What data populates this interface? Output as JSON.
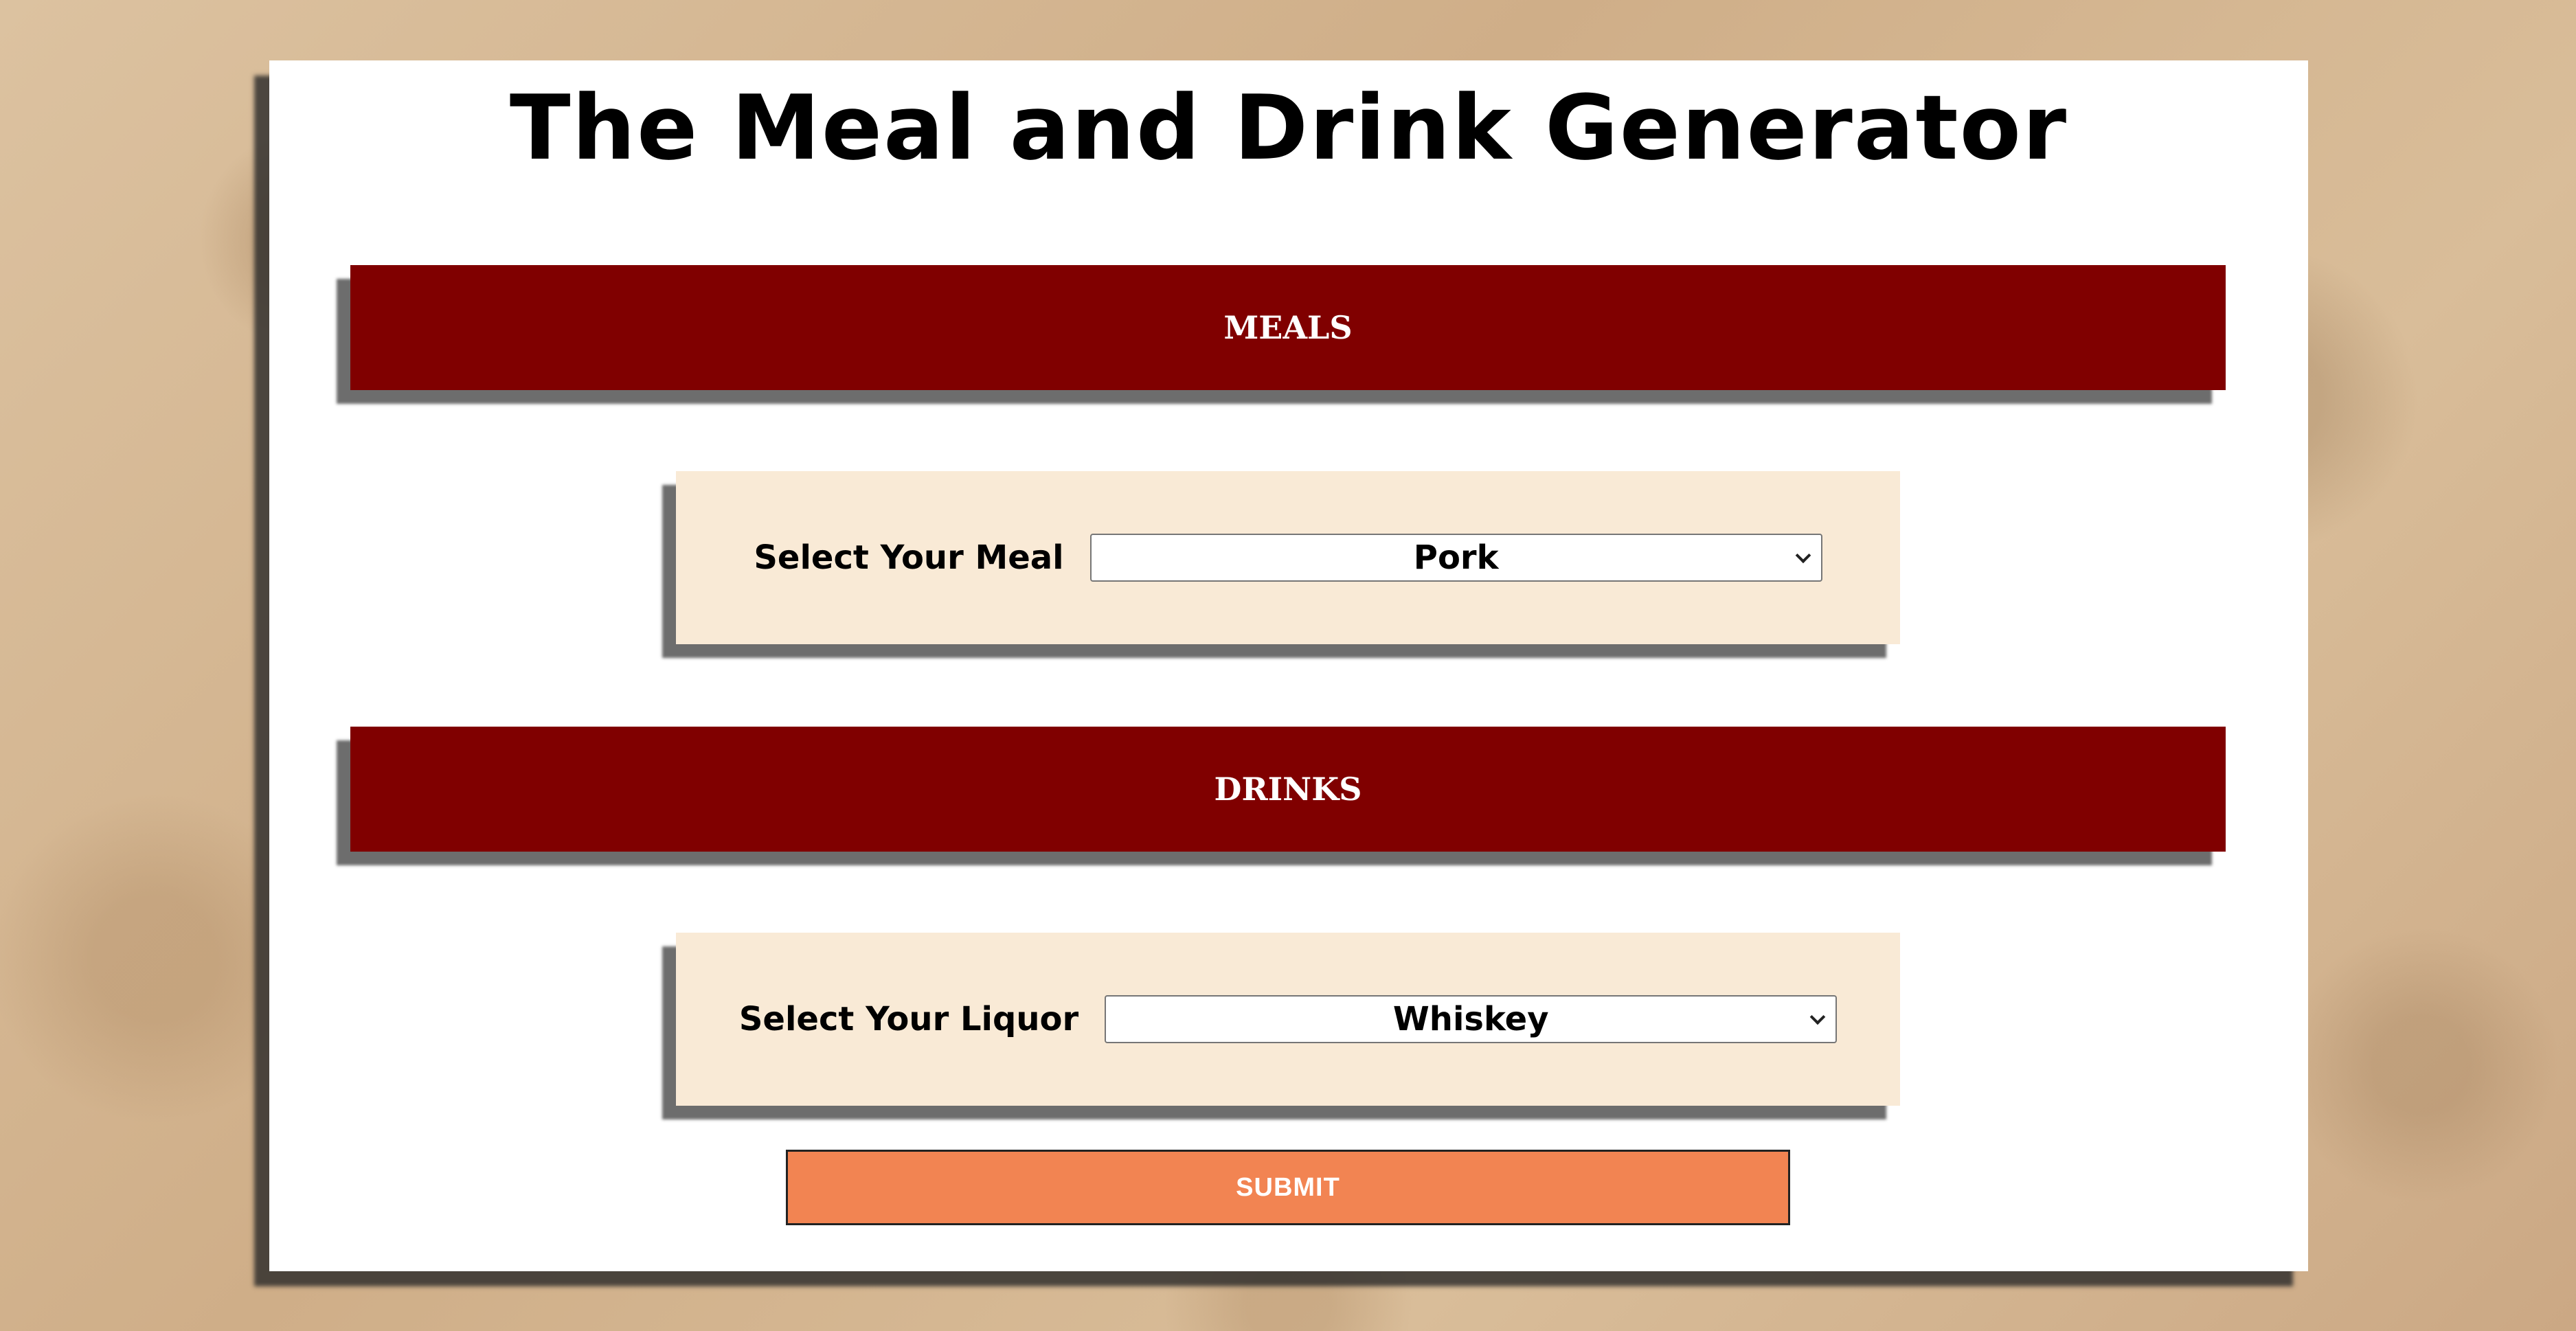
{
  "page": {
    "title": "The Meal and Drink Generator"
  },
  "sections": {
    "meals": {
      "heading": "MEALS",
      "label": "Select Your Meal",
      "selected": "Pork"
    },
    "drinks": {
      "heading": "DRINKS",
      "label": "Select Your Liquor",
      "selected": "Whiskey"
    }
  },
  "actions": {
    "submit_label": "SUBMIT"
  },
  "colors": {
    "banner": "#800000",
    "panel": "#f9ead6",
    "submit": "#f28452",
    "card": "#ffffff"
  }
}
